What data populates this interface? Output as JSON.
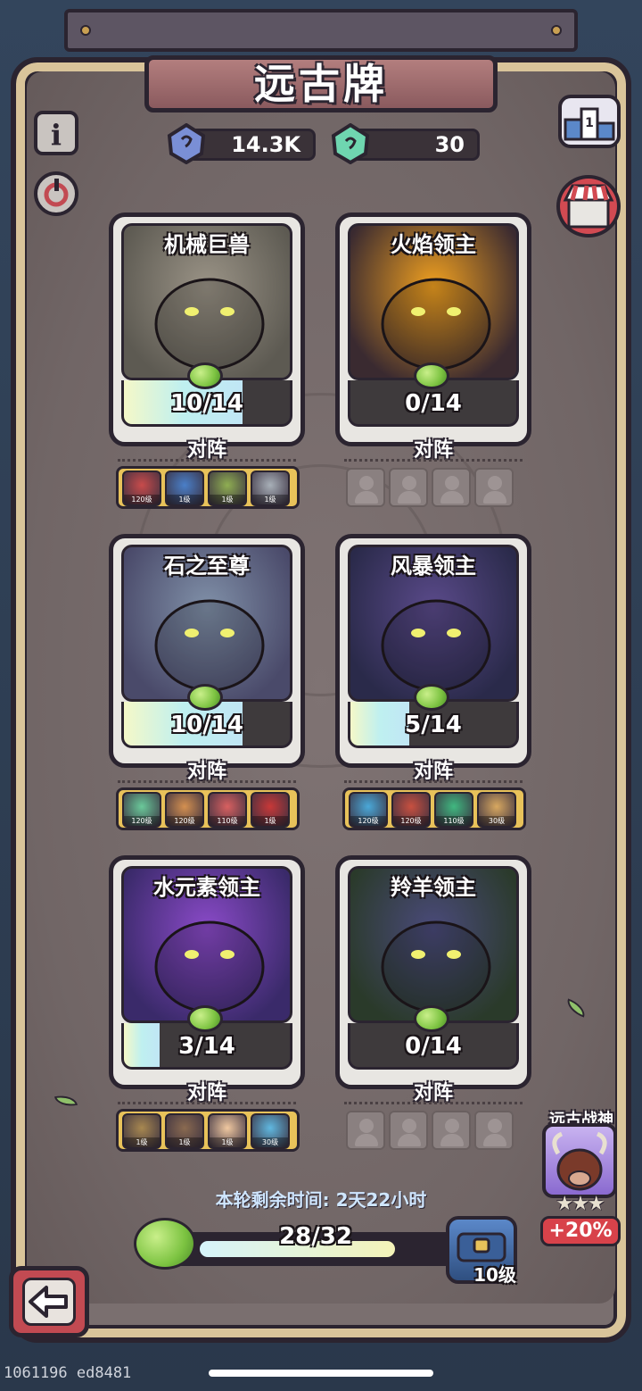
{
  "title": "远古牌",
  "currency": [
    {
      "icon": "blue-crystal-icon",
      "value": "14.3K",
      "color": "#7a8fd6"
    },
    {
      "icon": "green-crystal-icon",
      "value": "30",
      "color": "#6fd6b0"
    }
  ],
  "side_buttons": {
    "info": "info-icon",
    "refresh": "refresh-icon",
    "ranking": "ranking-podium-icon",
    "shop": "shop-icon"
  },
  "cards": [
    {
      "name": "机械巨兽",
      "progress": "10/14",
      "fraction": 0.714,
      "lineup_label": "对阵",
      "lineup_filled": true,
      "art_colors": [
        "#9a9386",
        "#5d5a52"
      ],
      "heroes": [
        {
          "level": "120级",
          "color": "#c84b4b"
        },
        {
          "level": "1级",
          "color": "#4a7fc8"
        },
        {
          "level": "1级",
          "color": "#8fae52"
        },
        {
          "level": "1级",
          "color": "#a8b0b8"
        }
      ]
    },
    {
      "name": "火焰领主",
      "progress": "0/14",
      "fraction": 0.0,
      "lineup_label": "对阵",
      "lineup_filled": false,
      "art_colors": [
        "#f0a020",
        "#3a2a30"
      ],
      "heroes": []
    },
    {
      "name": "石之至尊",
      "progress": "10/14",
      "fraction": 0.714,
      "lineup_label": "对阵",
      "lineup_filled": true,
      "art_colors": [
        "#8090a8",
        "#4a4a6a"
      ],
      "heroes": [
        {
          "level": "120级",
          "color": "#6ac99a"
        },
        {
          "level": "120级",
          "color": "#d49050"
        },
        {
          "level": "110级",
          "color": "#d86060"
        },
        {
          "level": "1级",
          "color": "#c83838"
        }
      ]
    },
    {
      "name": "风暴领主",
      "progress": "5/14",
      "fraction": 0.357,
      "lineup_label": "对阵",
      "lineup_filled": true,
      "art_colors": [
        "#5a4a8a",
        "#2a2a4a"
      ],
      "heroes": [
        {
          "level": "120级",
          "color": "#4aa8d8"
        },
        {
          "level": "120级",
          "color": "#c85040"
        },
        {
          "level": "110级",
          "color": "#40b880"
        },
        {
          "level": "30级",
          "color": "#d8a860"
        }
      ]
    },
    {
      "name": "水元素领主",
      "progress": "3/14",
      "fraction": 0.214,
      "lineup_label": "对阵",
      "lineup_filled": true,
      "art_colors": [
        "#8a4ac8",
        "#3a2a6a"
      ],
      "heroes": [
        {
          "level": "1级",
          "color": "#a88850"
        },
        {
          "level": "1级",
          "color": "#8a6a50"
        },
        {
          "level": "1级",
          "color": "#f0c8a0"
        },
        {
          "level": "30级",
          "color": "#60b8e0"
        }
      ]
    },
    {
      "name": "羚羊领主",
      "progress": "0/14",
      "fraction": 0.0,
      "lineup_label": "对阵",
      "lineup_filled": false,
      "art_colors": [
        "#4a4a7a",
        "#2a3a2a"
      ],
      "heroes": []
    }
  ],
  "timer": "本轮剩余时间: 2天22小时",
  "progress_bar": {
    "text": "28/32",
    "fraction": 0.875
  },
  "level": "10级",
  "bonus": {
    "name": "远古战神",
    "stars": "★★★",
    "percent": "+20%"
  },
  "back_button": "back-arrow-icon",
  "build_id": "1061196 ed8481"
}
